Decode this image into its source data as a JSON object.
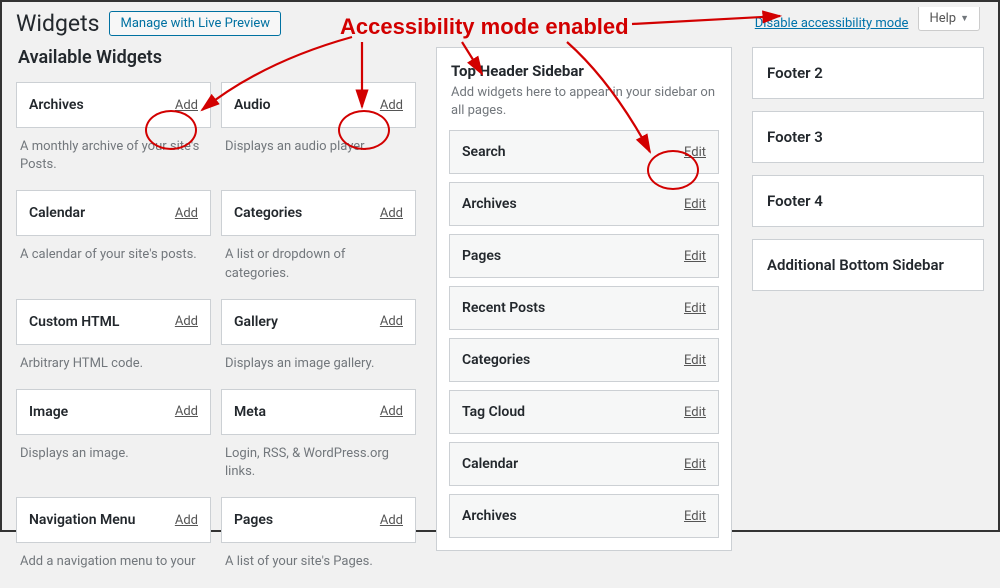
{
  "header": {
    "title": "Widgets",
    "livePreview": "Manage with Live Preview",
    "disableLink": "Disable accessibility mode",
    "helpLabel": "Help"
  },
  "available": {
    "title": "Available Widgets",
    "addLabel": "Add",
    "widgets": [
      {
        "name": "Archives",
        "desc": "A monthly archive of your site's Posts."
      },
      {
        "name": "Audio",
        "desc": "Displays an audio player."
      },
      {
        "name": "Calendar",
        "desc": "A calendar of your site's posts."
      },
      {
        "name": "Categories",
        "desc": "A list or dropdown of categories."
      },
      {
        "name": "Custom HTML",
        "desc": "Arbitrary HTML code."
      },
      {
        "name": "Gallery",
        "desc": "Displays an image gallery."
      },
      {
        "name": "Image",
        "desc": "Displays an image."
      },
      {
        "name": "Meta",
        "desc": "Login, RSS, & WordPress.org links."
      },
      {
        "name": "Navigation Menu",
        "desc": "Add a navigation menu to your"
      },
      {
        "name": "Pages",
        "desc": "A list of your site's Pages."
      }
    ]
  },
  "sidebar": {
    "title": "Top Header Sidebar",
    "desc": "Add widgets here to appear in your sidebar on all pages.",
    "editLabel": "Edit",
    "items": [
      {
        "name": "Search"
      },
      {
        "name": "Archives"
      },
      {
        "name": "Pages"
      },
      {
        "name": "Recent Posts"
      },
      {
        "name": "Categories"
      },
      {
        "name": "Tag Cloud"
      },
      {
        "name": "Calendar"
      },
      {
        "name": "Archives"
      }
    ]
  },
  "rightPanels": [
    {
      "title": "Footer 2"
    },
    {
      "title": "Footer 3"
    },
    {
      "title": "Footer 4"
    },
    {
      "title": "Additional Bottom Sidebar"
    }
  ],
  "annotation": {
    "label": "Accessibility mode enabled"
  }
}
